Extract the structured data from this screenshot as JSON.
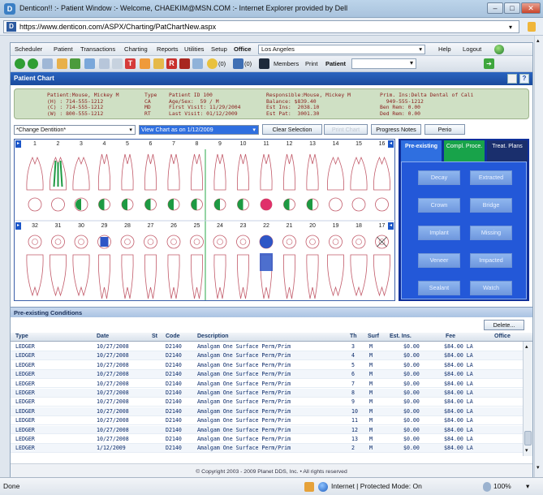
{
  "window": {
    "title": "Denticon!! :- Patient Window :- Welcome, CHAEKIM@MSN.COM :- Internet Explorer provided by Dell",
    "icon": "D"
  },
  "address": {
    "favicon": "D",
    "url": "https://www.denticon.com/ASPX/Charting/PatChartNew.aspx"
  },
  "menu": {
    "items": [
      "Scheduler",
      "Patient",
      "Transactions",
      "Charting",
      "Reports",
      "Utilities",
      "Setup"
    ],
    "office_label": "Office",
    "office_value": "Los Angeles",
    "help": "Help",
    "logout": "Logout"
  },
  "toolbar": {
    "count1": "(0)",
    "count2": "(0)",
    "members": "Members",
    "print": "Print",
    "patient": "Patient"
  },
  "chart_header": "Patient Chart",
  "patient_info": {
    "col1": "Patient:Mouse, Mickey M\n(H) : 714-555-1212\n(C) : 714-555-1212\n(W) : 800-555-1212",
    "col2": "Type\nCA\nMD\nRT",
    "col3": "Patient ID 100\nAge/Sex:  59 / M\nFirst Visit: 11/29/2004\nLast Visit: 01/12/2009",
    "col4": "Responsible:Mouse, Mickey M\nBalance: $839.40\nEst Ins:  2038.10\nEst Pat:  3001.30",
    "col5": "Prim. Ins:Delta Dental of Cali\n  949-555-1212\nBen Rem: 0.00\nDed Rem: 0.00"
  },
  "controls": {
    "dentition": "*Change Dentition*",
    "view_as": "View Chart as on 1/12/2009",
    "clear": "Clear Selection",
    "print_chart": "Print Chart",
    "progress": "Progress Notes",
    "perio": "Perio"
  },
  "upper_numbers": [
    "1",
    "2",
    "3",
    "4",
    "5",
    "6",
    "7",
    "8",
    "9",
    "10",
    "11",
    "12",
    "13",
    "14",
    "15",
    "16"
  ],
  "lower_numbers": [
    "32",
    "31",
    "30",
    "29",
    "28",
    "27",
    "26",
    "25",
    "24",
    "23",
    "22",
    "21",
    "20",
    "19",
    "18",
    "17"
  ],
  "side_tabs": [
    "Pre-existing",
    "Compl. Proce.",
    "Treat. Plans"
  ],
  "side_buttons": [
    "Decay",
    "Extracted",
    "Crown",
    "Bridge",
    "Implant",
    "Missing",
    "Veneer",
    "Impacted",
    "Sealant",
    "Watch"
  ],
  "pre_existing": {
    "title": "Pre-existing Conditions",
    "delete": "Delete...",
    "headers": [
      "Type",
      "Date",
      "St",
      "Code",
      "Description",
      "Th",
      "Surf",
      "Est. Ins.",
      "Fee",
      "Office"
    ],
    "rows": [
      [
        "LEDGER",
        "10/27/2008",
        "",
        "D2140",
        "Amalgam One Surface Perm/Prim",
        "3",
        "M",
        "$0.00",
        "$84.00 LA"
      ],
      [
        "LEDGER",
        "10/27/2008",
        "",
        "D2140",
        "Amalgam One Surface Perm/Prim",
        "4",
        "M",
        "$0.00",
        "$84.00 LA"
      ],
      [
        "LEDGER",
        "10/27/2008",
        "",
        "D2140",
        "Amalgam One Surface Perm/Prim",
        "5",
        "M",
        "$0.00",
        "$84.00 LA"
      ],
      [
        "LEDGER",
        "10/27/2008",
        "",
        "D2140",
        "Amalgam One Surface Perm/Prim",
        "6",
        "M",
        "$0.00",
        "$84.00 LA"
      ],
      [
        "LEDGER",
        "10/27/2008",
        "",
        "D2140",
        "Amalgam One Surface Perm/Prim",
        "7",
        "M",
        "$0.00",
        "$84.00 LA"
      ],
      [
        "LEDGER",
        "10/27/2008",
        "",
        "D2140",
        "Amalgam One Surface Perm/Prim",
        "8",
        "M",
        "$0.00",
        "$84.00 LA"
      ],
      [
        "LEDGER",
        "10/27/2008",
        "",
        "D2140",
        "Amalgam One Surface Perm/Prim",
        "9",
        "M",
        "$0.00",
        "$84.00 LA"
      ],
      [
        "LEDGER",
        "10/27/2008",
        "",
        "D2140",
        "Amalgam One Surface Perm/Prim",
        "10",
        "M",
        "$0.00",
        "$84.00 LA"
      ],
      [
        "LEDGER",
        "10/27/2008",
        "",
        "D2140",
        "Amalgam One Surface Perm/Prim",
        "11",
        "M",
        "$0.00",
        "$84.00 LA"
      ],
      [
        "LEDGER",
        "10/27/2008",
        "",
        "D2140",
        "Amalgam One Surface Perm/Prim",
        "12",
        "M",
        "$0.00",
        "$84.00 LA"
      ],
      [
        "LEDGER",
        "10/27/2008",
        "",
        "D2140",
        "Amalgam One Surface Perm/Prim",
        "13",
        "M",
        "$0.00",
        "$84.00 LA"
      ],
      [
        "LEDGER",
        "1/12/2009",
        "",
        "D2140",
        "Amalgam One Surface Perm/Prim",
        "2",
        "M",
        "$0.00",
        "$84.00 LA"
      ]
    ]
  },
  "footer": "© Copyright 2003 - 2009 Planet DDS, Inc. • All rights reserved",
  "status": {
    "left": "Done",
    "zone": "Internet | Protected Mode: On",
    "zoom": "100%"
  },
  "colors": {
    "header_blue": "#1a4b9d",
    "info_green": "#cfe0c4",
    "side_panel": "#0f2f9a",
    "accent_pink": "#e0306a"
  }
}
